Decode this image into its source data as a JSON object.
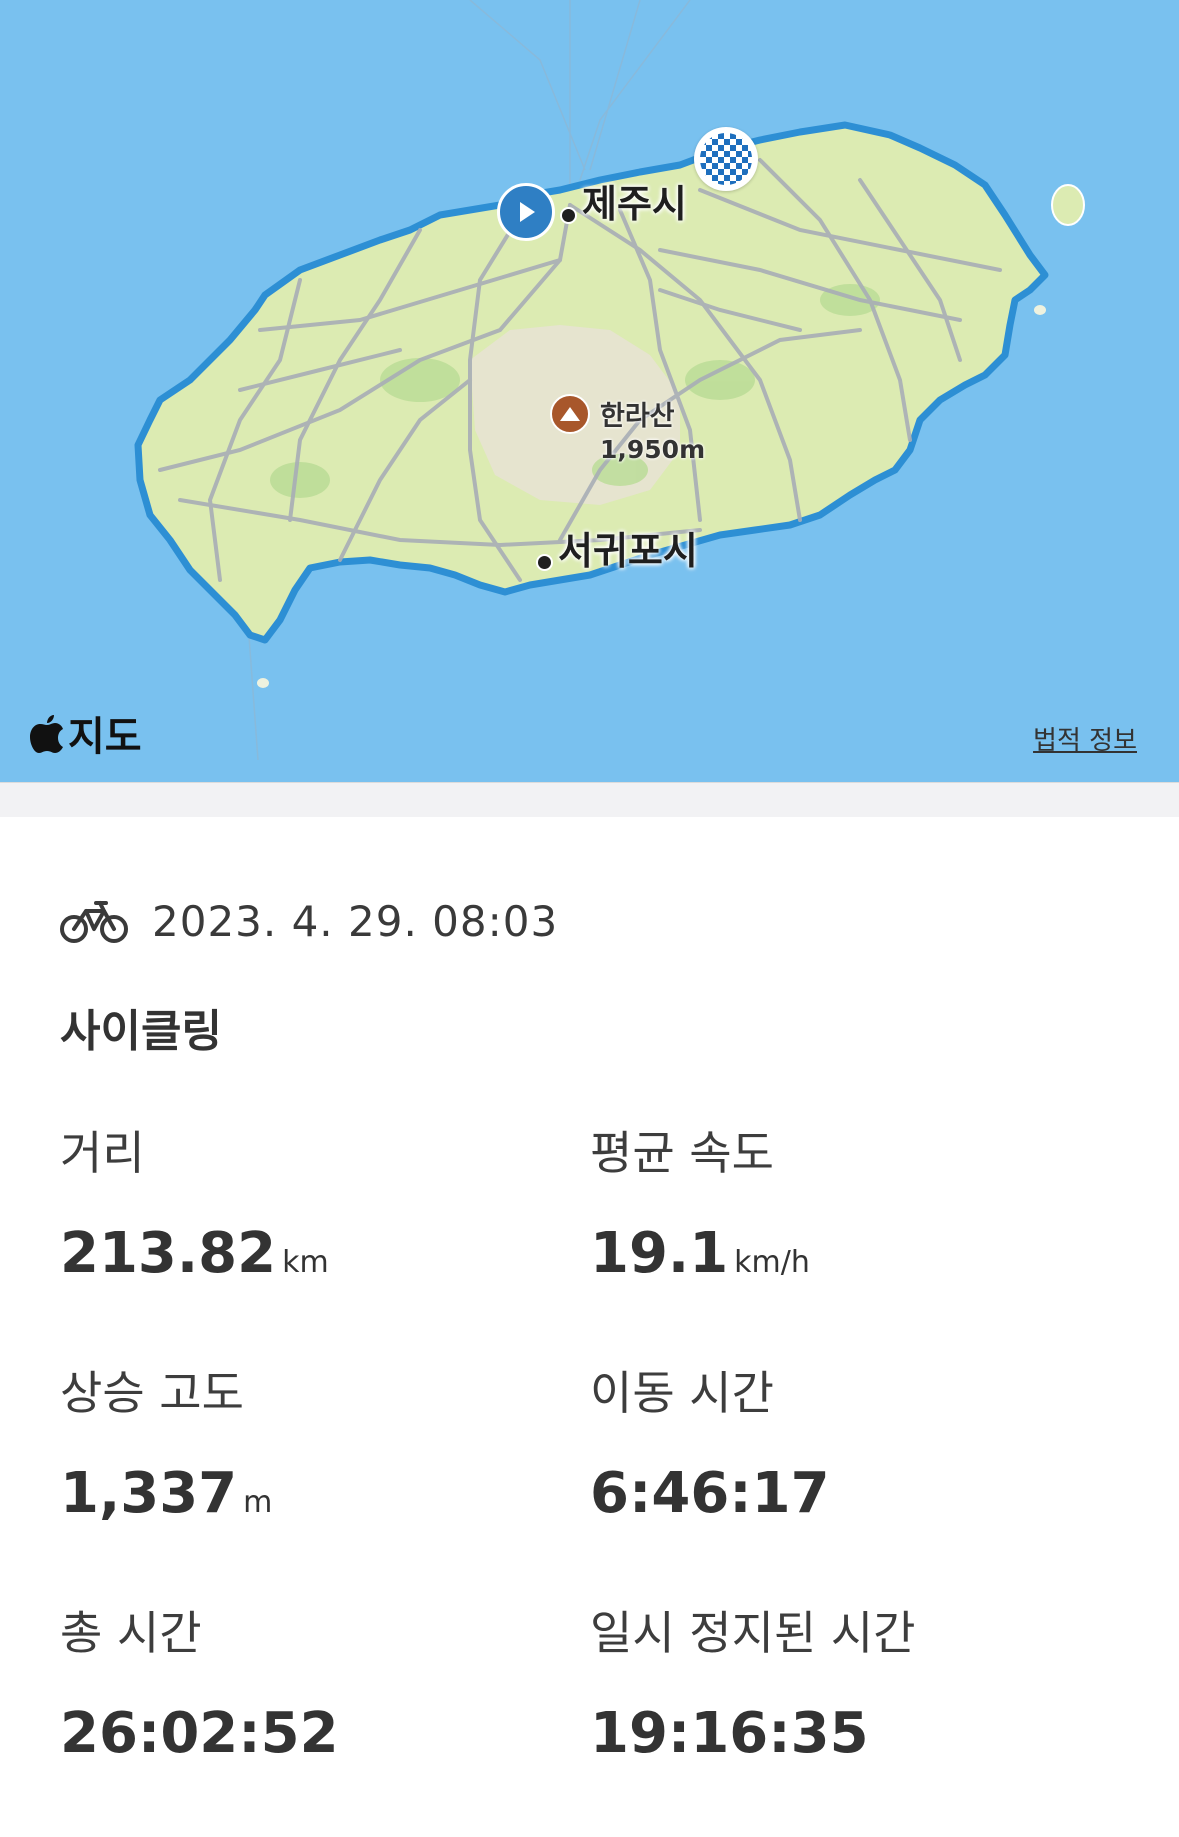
{
  "map": {
    "cities": [
      {
        "name": "제주시"
      },
      {
        "name": "서귀포시"
      }
    ],
    "peak": {
      "name": "한라산",
      "height": "1,950m"
    },
    "brand_label": "지도",
    "legal_label": "법적 정보",
    "colors": {
      "sea": "#79c1ef",
      "land": "#dcebb2",
      "route": "#2d8fd4",
      "roads": "#a8aeb6"
    }
  },
  "activity": {
    "icon": "bicycle-icon",
    "datetime": "2023. 4. 29. 08:03",
    "type": "사이클링"
  },
  "stats": [
    {
      "label": "거리",
      "value": "213.82",
      "unit": "km"
    },
    {
      "label": "평균 속도",
      "value": "19.1",
      "unit": "km/h"
    },
    {
      "label": "상승 고도",
      "value": "1,337",
      "unit": "m"
    },
    {
      "label": "이동 시간",
      "value": "6:46:17",
      "unit": ""
    },
    {
      "label": "총 시간",
      "value": "26:02:52",
      "unit": ""
    },
    {
      "label": "일시 정지된 시간",
      "value": "19:16:35",
      "unit": ""
    }
  ]
}
